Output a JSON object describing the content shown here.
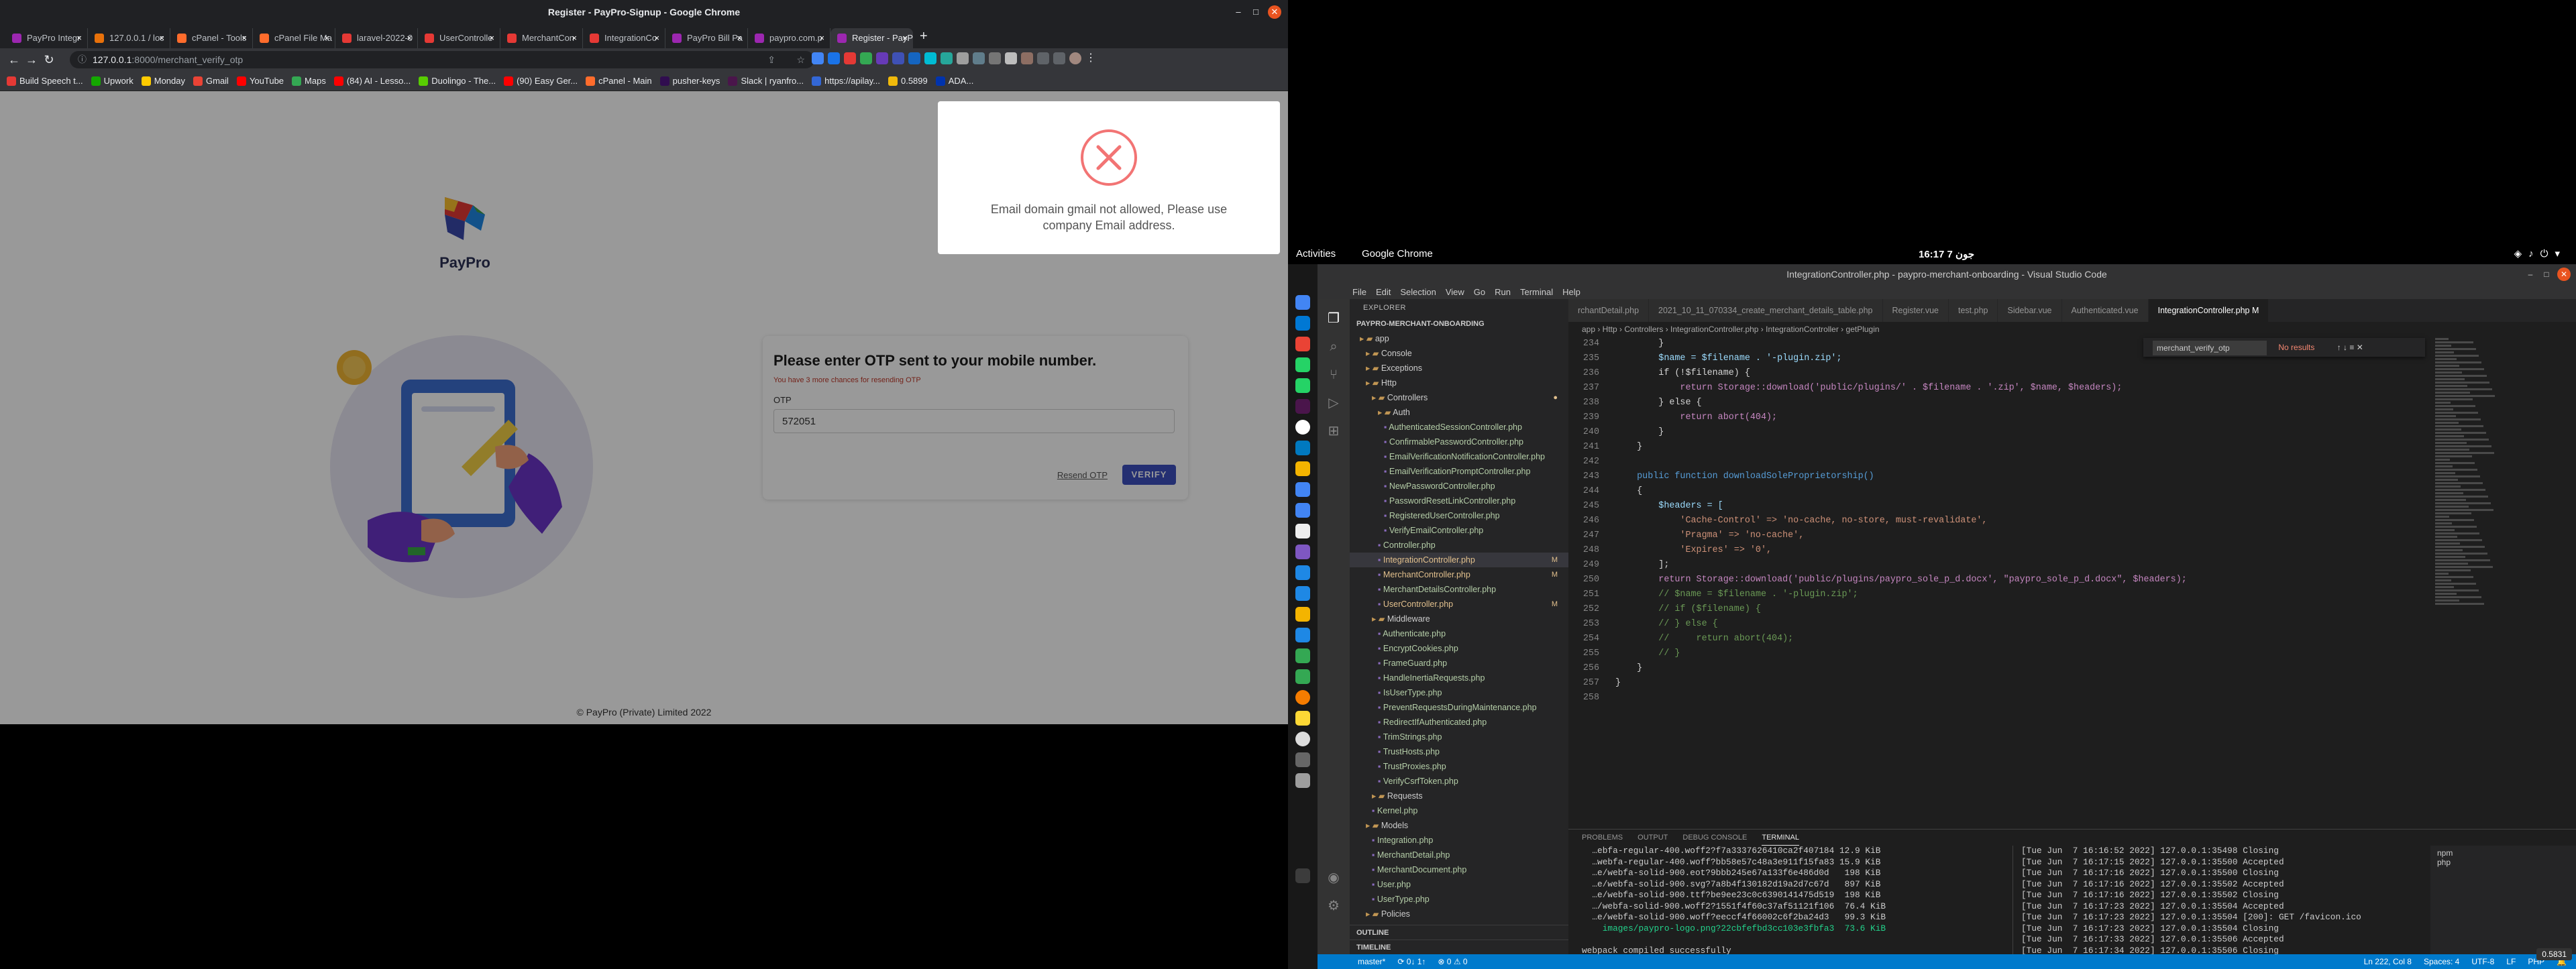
{
  "chrome": {
    "window_title": "Register - PayPro-Signup - Google Chrome",
    "tabs": [
      {
        "label": "PayPro Integr",
        "color": "#9c27b0"
      },
      {
        "label": "127.0.0.1 / loc",
        "color": "#e8710a"
      },
      {
        "label": "cPanel - Tools",
        "color": "#ff6c2c"
      },
      {
        "label": "cPanel File Ma",
        "color": "#ff6c2c"
      },
      {
        "label": "laravel-2022-0",
        "color": "#e53935"
      },
      {
        "label": "UserControlle",
        "color": "#e53935"
      },
      {
        "label": "MerchantCon",
        "color": "#e53935"
      },
      {
        "label": "IntegrationCo",
        "color": "#e53935"
      },
      {
        "label": "PayPro Bill Pa",
        "color": "#9c27b0"
      },
      {
        "label": "paypro.com.p",
        "color": "#9c27b0"
      },
      {
        "label": "Register - PayP",
        "color": "#9c27b0",
        "active": true
      }
    ],
    "url_host": "127.0.0.1",
    "url_path": ":8000/merchant_verify_otp",
    "bookmarks": [
      {
        "label": "Build Speech t...",
        "color": "#e53935"
      },
      {
        "label": "Upwork",
        "color": "#14a800"
      },
      {
        "label": "Monday",
        "color": "#ffcb00"
      },
      {
        "label": "Gmail",
        "color": "#ea4335"
      },
      {
        "label": "YouTube",
        "color": "#ff0000"
      },
      {
        "label": "Maps",
        "color": "#34a853"
      },
      {
        "label": "(84) AI - Lesso...",
        "color": "#ff0000"
      },
      {
        "label": "Duolingo - The...",
        "color": "#58cc02"
      },
      {
        "label": "(90) Easy Ger...",
        "color": "#ff0000"
      },
      {
        "label": "cPanel - Main",
        "color": "#ff6c2c"
      },
      {
        "label": "pusher-keys",
        "color": "#300d4f"
      },
      {
        "label": "Slack | ryanfro...",
        "color": "#4a154b"
      },
      {
        "label": "https://apilay...",
        "color": "#3367d6"
      },
      {
        "label": "0.5899",
        "color": "#f0b90b"
      },
      {
        "label": "ADA...",
        "color": "#0033ad"
      }
    ]
  },
  "page": {
    "brand": "PayPro",
    "otp_title": "Please enter OTP sent to your mobile number.",
    "otp_subtitle": "You have 3 more chances for resending OTP",
    "otp_label": "OTP",
    "otp_value": "572051",
    "resend_label": "Resend OTP",
    "verify_label": "VERIFY",
    "footer": "© PayPro (Private) Limited 2022",
    "modal_message": "Email domain gmail not allowed, Please use company Email address.",
    "colors": {
      "error": "#f27474",
      "primary": "#3c4fbf"
    }
  },
  "gnome": {
    "activities": "Activities",
    "app": "Google Chrome",
    "clock": "16:17  جون 7"
  },
  "vscode": {
    "title": "IntegrationController.php - paypro-merchant-onboarding - Visual Studio Code",
    "menu": [
      "File",
      "Edit",
      "Selection",
      "View",
      "Go",
      "Run",
      "Terminal",
      "Help"
    ],
    "explorer_label": "EXPLORER",
    "project": "PAYPRO-MERCHANT-ONBOARDING",
    "tree": [
      {
        "label": "app",
        "indent": 1,
        "type": "folder"
      },
      {
        "label": "Console",
        "indent": 2,
        "type": "folder"
      },
      {
        "label": "Exceptions",
        "indent": 2,
        "type": "folder"
      },
      {
        "label": "Http",
        "indent": 2,
        "type": "folder"
      },
      {
        "label": "Controllers",
        "indent": 3,
        "type": "folder",
        "mod": true
      },
      {
        "label": "Auth",
        "indent": 4,
        "type": "folder"
      },
      {
        "label": "AuthenticatedSessionController.php",
        "indent": 5,
        "type": "php"
      },
      {
        "label": "ConfirmablePasswordController.php",
        "indent": 5,
        "type": "php"
      },
      {
        "label": "EmailVerificationNotificationController.php",
        "indent": 5,
        "type": "php"
      },
      {
        "label": "EmailVerificationPromptController.php",
        "indent": 5,
        "type": "php"
      },
      {
        "label": "NewPasswordController.php",
        "indent": 5,
        "type": "php"
      },
      {
        "label": "PasswordResetLinkController.php",
        "indent": 5,
        "type": "php"
      },
      {
        "label": "RegisteredUserController.php",
        "indent": 5,
        "type": "php"
      },
      {
        "label": "VerifyEmailController.php",
        "indent": 5,
        "type": "php"
      },
      {
        "label": "Controller.php",
        "indent": 4,
        "type": "php"
      },
      {
        "label": "IntegrationController.php",
        "indent": 4,
        "type": "php",
        "mod": true,
        "selected": true
      },
      {
        "label": "MerchantController.php",
        "indent": 4,
        "type": "php",
        "mod": true
      },
      {
        "label": "MerchantDetailsController.php",
        "indent": 4,
        "type": "php"
      },
      {
        "label": "UserController.php",
        "indent": 4,
        "type": "php",
        "mod": true
      },
      {
        "label": "Middleware",
        "indent": 3,
        "type": "folder"
      },
      {
        "label": "Authenticate.php",
        "indent": 4,
        "type": "php"
      },
      {
        "label": "EncryptCookies.php",
        "indent": 4,
        "type": "php"
      },
      {
        "label": "FrameGuard.php",
        "indent": 4,
        "type": "php"
      },
      {
        "label": "HandleInertiaRequests.php",
        "indent": 4,
        "type": "php"
      },
      {
        "label": "IsUserType.php",
        "indent": 4,
        "type": "php"
      },
      {
        "label": "PreventRequestsDuringMaintenance.php",
        "indent": 4,
        "type": "php"
      },
      {
        "label": "RedirectIfAuthenticated.php",
        "indent": 4,
        "type": "php"
      },
      {
        "label": "TrimStrings.php",
        "indent": 4,
        "type": "php"
      },
      {
        "label": "TrustHosts.php",
        "indent": 4,
        "type": "php"
      },
      {
        "label": "TrustProxies.php",
        "indent": 4,
        "type": "php"
      },
      {
        "label": "VerifyCsrfToken.php",
        "indent": 4,
        "type": "php"
      },
      {
        "label": "Requests",
        "indent": 3,
        "type": "folder"
      },
      {
        "label": "Kernel.php",
        "indent": 3,
        "type": "php"
      },
      {
        "label": "Models",
        "indent": 2,
        "type": "folder"
      },
      {
        "label": "Integration.php",
        "indent": 3,
        "type": "php"
      },
      {
        "label": "MerchantDetail.php",
        "indent": 3,
        "type": "php"
      },
      {
        "label": "MerchantDocument.php",
        "indent": 3,
        "type": "php"
      },
      {
        "label": "User.php",
        "indent": 3,
        "type": "php"
      },
      {
        "label": "UserType.php",
        "indent": 3,
        "type": "php"
      },
      {
        "label": "Policies",
        "indent": 2,
        "type": "folder"
      }
    ],
    "outline_label": "OUTLINE",
    "timeline_label": "TIMELINE",
    "editor_tabs": [
      {
        "label": "rchantDetail.php"
      },
      {
        "label": "2021_10_11_070334_create_merchant_details_table.php"
      },
      {
        "label": "Register.vue"
      },
      {
        "label": "test.php"
      },
      {
        "label": "Sidebar.vue"
      },
      {
        "label": "Authenticated.vue"
      },
      {
        "label": "IntegrationController.php M",
        "active": true
      }
    ],
    "breadcrumb": "app › Http › Controllers › IntegrationController.php › IntegrationController › getPlugin",
    "find_value": "merchant_verify_otp",
    "find_result": "No results",
    "code_lines": [
      {
        "n": "234",
        "t": "        }"
      },
      {
        "n": "235",
        "t": "        $name = $filename . '-plugin.zip';"
      },
      {
        "n": "236",
        "t": "        if (!$filename) {"
      },
      {
        "n": "237",
        "t": "            return Storage::download('public/plugins/' . $filename . '.zip', $name, $headers);"
      },
      {
        "n": "238",
        "t": "        } else {"
      },
      {
        "n": "239",
        "t": "            return abort(404);"
      },
      {
        "n": "240",
        "t": "        }"
      },
      {
        "n": "241",
        "t": "    }"
      },
      {
        "n": "242",
        "t": ""
      },
      {
        "n": "243",
        "t": "    public function downloadSoleProprietorship()"
      },
      {
        "n": "244",
        "t": "    {"
      },
      {
        "n": "245",
        "t": "        $headers = ["
      },
      {
        "n": "246",
        "t": "            'Cache-Control' => 'no-cache, no-store, must-revalidate',"
      },
      {
        "n": "247",
        "t": "            'Pragma' => 'no-cache',"
      },
      {
        "n": "248",
        "t": "            'Expires' => '0',"
      },
      {
        "n": "249",
        "t": "        ];"
      },
      {
        "n": "250",
        "t": "        return Storage::download('public/plugins/paypro_sole_p_d.docx', \"paypro_sole_p_d.docx\", $headers);"
      },
      {
        "n": "251",
        "t": "        // $name = $filename . '-plugin.zip';"
      },
      {
        "n": "252",
        "t": "        // if ($filename) {"
      },
      {
        "n": "253",
        "t": "        // } else {"
      },
      {
        "n": "254",
        "t": "        //     return abort(404);"
      },
      {
        "n": "255",
        "t": "        // }"
      },
      {
        "n": "256",
        "t": "    }"
      },
      {
        "n": "257",
        "t": "}"
      },
      {
        "n": "258",
        "t": ""
      }
    ],
    "panel_tabs": [
      "PROBLEMS",
      "OUTPUT",
      "DEBUG CONSOLE",
      "TERMINAL"
    ],
    "terminal_left": [
      "  …ebfa-regular-400.woff2?f7a3337626410ca2f407184 12.9 KiB",
      "  …webfa-regular-400.woff?bb58e57c48a3e911f15fa83 15.9 KiB",
      "  …e/webfa-solid-900.eot?9bbb245e67a133f6e486d0d   198 KiB",
      "  …e/webfa-solid-900.svg?7a8b4f130182d19a2d7c67d   897 KiB",
      "  …e/webfa-solid-900.ttf?be9ee23c0c6390141475d519  198 KiB",
      "  …/webfa-solid-900.woff2?1551f4f60c37af51121f106  76.4 KiB",
      "  …e/webfa-solid-900.woff?eeccf4f66002c6f2ba24d3   99.3 KiB",
      "    images/paypro-logo.png?22cbfefbd3cc103e3fbfa3  73.6 KiB",
      "",
      "webpack compiled successfully"
    ],
    "terminal_right": [
      "[Tue Jun  7 16:16:52 2022] 127.0.0.1:35498 Closing",
      "[Tue Jun  7 16:17:15 2022] 127.0.0.1:35500 Accepted",
      "[Tue Jun  7 16:17:16 2022] 127.0.0.1:35500 Closing",
      "[Tue Jun  7 16:17:16 2022] 127.0.0.1:35502 Accepted",
      "[Tue Jun  7 16:17:16 2022] 127.0.0.1:35502 Closing",
      "[Tue Jun  7 16:17:23 2022] 127.0.0.1:35504 Accepted",
      "[Tue Jun  7 16:17:23 2022] 127.0.0.1:35504 [200]: GET /favicon.ico",
      "[Tue Jun  7 16:17:23 2022] 127.0.0.1:35504 Closing",
      "[Tue Jun  7 16:17:33 2022] 127.0.0.1:35506 Accepted",
      "[Tue Jun  7 16:17:34 2022] 127.0.0.1:35506 Closing"
    ],
    "terminal_list": [
      "npm",
      "php"
    ],
    "status_left": [
      "master*",
      "⟳ 0↓ 1↑",
      "⊗ 0 ⚠ 0"
    ],
    "status_right": [
      "Ln 222, Col 8",
      "Spaces: 4",
      "UTF-8",
      "LF",
      "PHP",
      "🔔"
    ],
    "corner_value": "0.5831"
  }
}
